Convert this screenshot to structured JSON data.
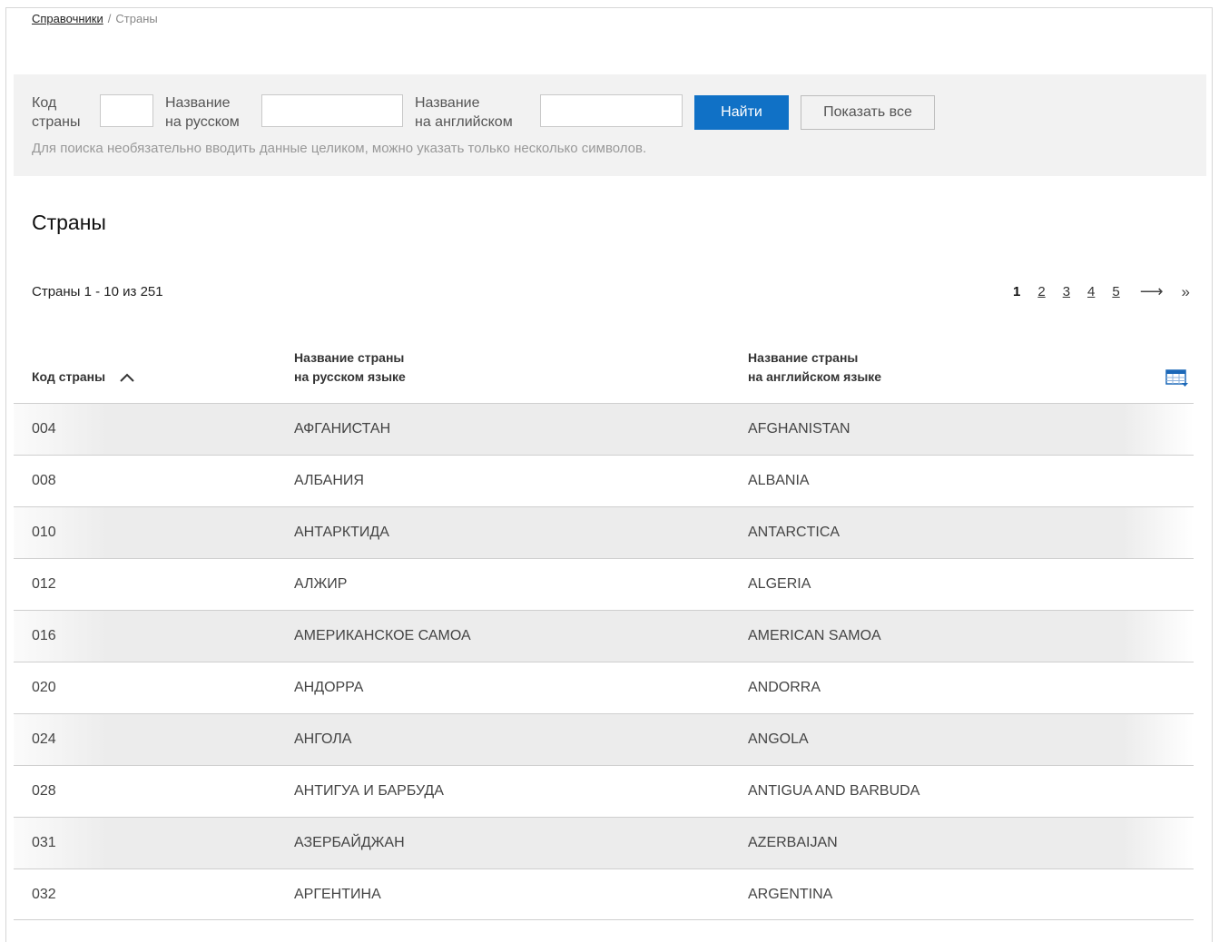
{
  "breadcrumb": {
    "root": "Справочники",
    "separator": "/",
    "current": "Страны"
  },
  "search": {
    "code_label_1": "Код",
    "code_label_2": "страны",
    "code_value": "",
    "ru_label_1": "Название",
    "ru_label_2": "на русском",
    "ru_value": "",
    "en_label_1": "Название",
    "en_label_2": "на английском",
    "en_value": "",
    "find_button": "Найти",
    "show_all_button": "Показать все",
    "hint": "Для поиска необязательно вводить данные целиком, можно указать только несколько символов."
  },
  "page_title": "Страны",
  "records_count": "Страны 1 - 10 из 251",
  "pagination": {
    "pages": [
      "1",
      "2",
      "3",
      "4",
      "5"
    ],
    "current": "1",
    "next": "⟶",
    "last": "»"
  },
  "table": {
    "headers": {
      "code": "Код страны",
      "ru_1": "Название страны",
      "ru_2": "на русском языке",
      "en_1": "Название страны",
      "en_2": "на английском языке"
    },
    "sort": "ascending",
    "rows": [
      {
        "code": "004",
        "ru": "АФГАНИСТАН",
        "en": "AFGHANISTAN"
      },
      {
        "code": "008",
        "ru": "АЛБАНИЯ",
        "en": "ALBANIA"
      },
      {
        "code": "010",
        "ru": "АНТАРКТИДА",
        "en": "ANTARCTICA"
      },
      {
        "code": "012",
        "ru": "АЛЖИР",
        "en": "ALGERIA"
      },
      {
        "code": "016",
        "ru": "АМЕРИКАНСКОЕ САМОА",
        "en": "AMERICAN SAMOA"
      },
      {
        "code": "020",
        "ru": "АНДОРРА",
        "en": "ANDORRA"
      },
      {
        "code": "024",
        "ru": "АНГОЛА",
        "en": "ANGOLA"
      },
      {
        "code": "028",
        "ru": "АНТИГУА И БАРБУДА",
        "en": "ANTIGUA AND BARBUDA"
      },
      {
        "code": "031",
        "ru": "АЗЕРБАЙДЖАН",
        "en": "AZERBAIJAN"
      },
      {
        "code": "032",
        "ru": "АРГЕНТИНА",
        "en": "ARGENTINA"
      }
    ]
  },
  "colors": {
    "primary_button": "#1071c6",
    "panel_bg": "#f2f2f2",
    "row_shade": "#ececec"
  }
}
